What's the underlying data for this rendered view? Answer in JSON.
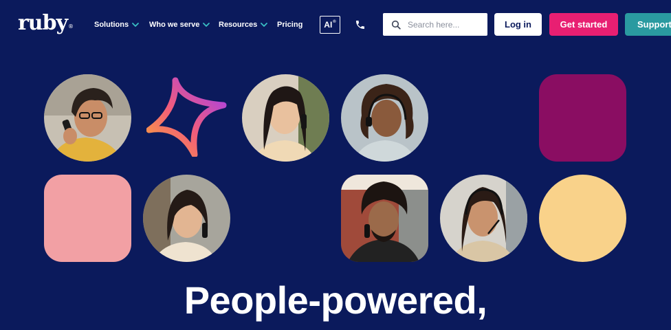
{
  "brand": {
    "logo_text": "ruby",
    "logo_mark": "®"
  },
  "nav": {
    "items": [
      {
        "label": "Solutions",
        "has_dropdown": true
      },
      {
        "label": "Who we serve",
        "has_dropdown": true
      },
      {
        "label": "Resources",
        "has_dropdown": true
      },
      {
        "label": "Pricing",
        "has_dropdown": false
      }
    ],
    "ai_label": "AI",
    "ai_sup": "®",
    "phone_icon": "phone-icon"
  },
  "search": {
    "placeholder": "Search here...",
    "value": "",
    "icon": "search-icon"
  },
  "buttons": {
    "login": "Log in",
    "get_started": "Get started",
    "support": "Support"
  },
  "hero": {
    "headline": "People-powered,"
  },
  "colors": {
    "background": "#0b1a5c",
    "accent_pink": "#e81f72",
    "accent_teal": "#2a9aa0",
    "tile_plum": "#8a0d62",
    "tile_blush": "#f2a0a4",
    "tile_butter": "#f9d28a"
  }
}
